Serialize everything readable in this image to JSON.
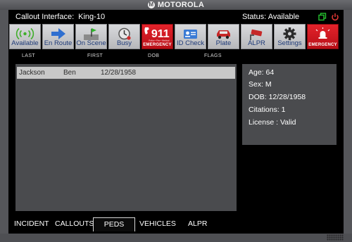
{
  "brand": {
    "name": "MOTOROLA",
    "logo": "M"
  },
  "header": {
    "title_prefix": "Callout Interface:",
    "unit": "King-10",
    "status": "Status: Available"
  },
  "toolbar": [
    {
      "label": "Available",
      "icon": "radio-signal-icon"
    },
    {
      "label": "En Route",
      "icon": "arrow-right-icon"
    },
    {
      "label": "On Scene",
      "icon": "map-pin-icon"
    },
    {
      "label": "Busy",
      "icon": "clock-icon"
    },
    {
      "label": "EMERGENCY",
      "icon": "911-phone-icon",
      "big_text": "911",
      "small_text": "Police • Fire • Medical"
    },
    {
      "label": "ID Check",
      "icon": "id-card-icon"
    },
    {
      "label": "Plate",
      "icon": "car-icon"
    },
    {
      "label": "ALPR",
      "icon": "camera-icon"
    },
    {
      "label": "Settings",
      "icon": "gear-icon"
    },
    {
      "label": "EMERGENCY",
      "icon": "alarm-icon"
    }
  ],
  "table": {
    "columns": [
      "LAST",
      "FIRST",
      "DOB",
      "FLAGS"
    ],
    "rows": [
      {
        "last": "Jackson",
        "first": "Ben",
        "dob": "12/28/1958",
        "flags": ""
      }
    ]
  },
  "details": {
    "age": "Age: 64",
    "sex": "Sex: M",
    "dob": "DOB: 12/28/1958",
    "citations": "Citations: 1",
    "license": "License  : Valid"
  },
  "tabs": [
    "INCIDENT",
    "CALLOUTS",
    "PEDS",
    "VEHICLES",
    "ALPR"
  ],
  "active_tab": "PEDS",
  "colors": {
    "toolbar_label": "#1e3a78",
    "emergency_red": "#e4232b",
    "min_icon": "#25c12f",
    "close_icon": "#e53935",
    "screen_bg": "#000000",
    "panel_bg": "#4a4b4e",
    "row_bg": "#c8c8c8"
  }
}
